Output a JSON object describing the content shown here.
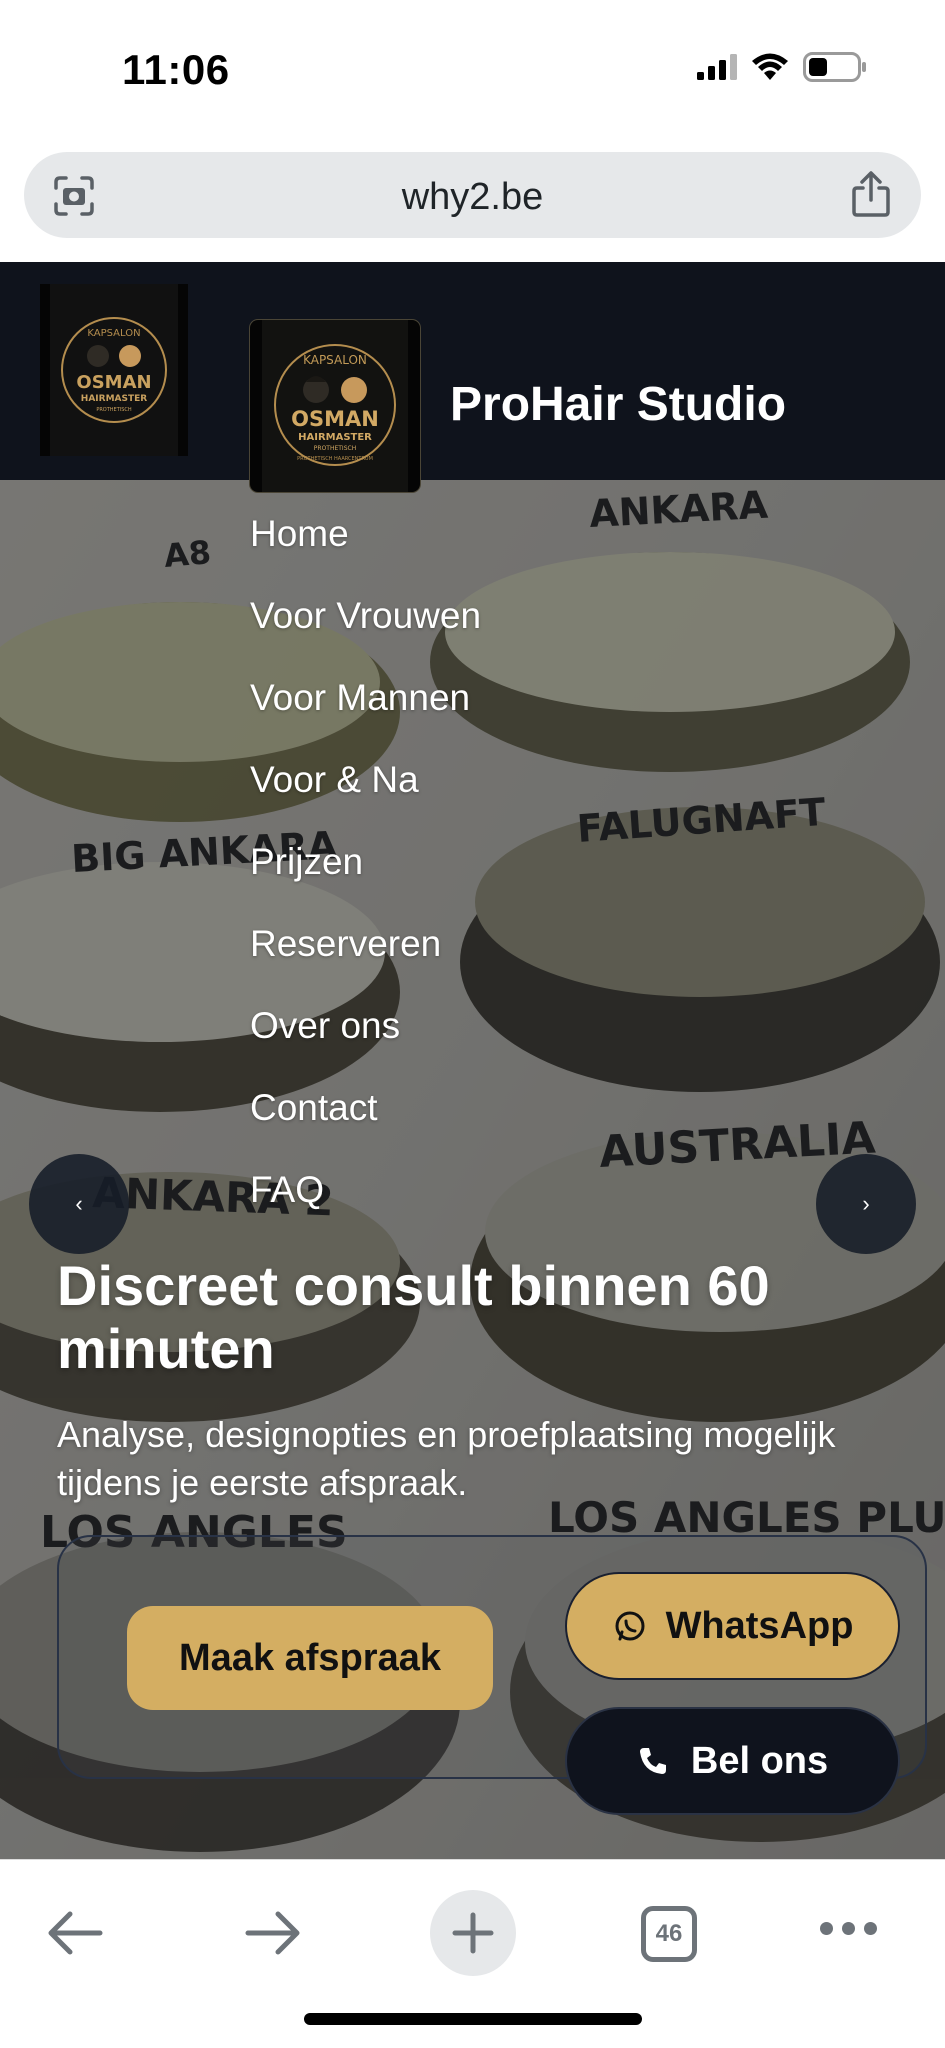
{
  "status_bar": {
    "time": "11:06",
    "icons": [
      "signal-icon",
      "wifi-icon",
      "battery-icon"
    ]
  },
  "browser": {
    "url": "why2.be",
    "left_icon": "camera-scan-icon",
    "right_icon": "share-icon",
    "tab_count": "46"
  },
  "site": {
    "title": "ProHair Studio",
    "logo": {
      "line1": "KAPSALON",
      "line2": "OSMAN",
      "line3": "HAIRMASTER",
      "line4": "PROTHETISCH",
      "line5": "PROTHETISCH HAARCENTRUM"
    },
    "nav": [
      {
        "label": "Home"
      },
      {
        "label": "Voor Vrouwen"
      },
      {
        "label": "Voor Mannen"
      },
      {
        "label": "Voor & Na"
      },
      {
        "label": "Prijzen"
      },
      {
        "label": "Reserveren"
      },
      {
        "label": "Over ons"
      },
      {
        "label": "Contact"
      },
      {
        "label": "FAQ"
      }
    ],
    "carousel": {
      "prev": "‹",
      "next": "›"
    },
    "hero": {
      "heading": "Discreet consult binnen 60 minuten",
      "subtext": "Analyse, designopties en proefplaatsing mogelijk tijdens je eerste afspraak."
    },
    "product_labels": [
      "A8",
      "ANKARA",
      "BIG ANKARA",
      "FALUGNAFT",
      "ANKARA 2",
      "AUSTRALIA",
      "LOS ANGLES",
      "LOS ANGLES PLUS"
    ],
    "buttons": {
      "appointment": "Maak afspraak",
      "whatsapp": "WhatsApp",
      "call": "Bel ons"
    }
  },
  "colors": {
    "header_bg": "#0f131c",
    "gold": "#d4ae62",
    "dark_button": "#0f131d"
  }
}
